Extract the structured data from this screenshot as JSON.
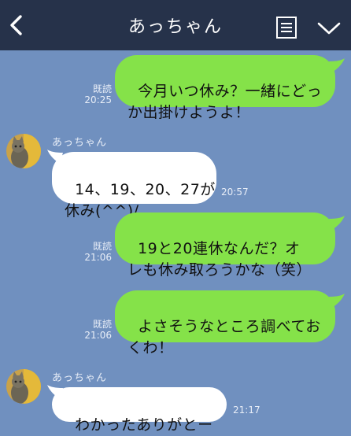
{
  "header": {
    "title": "あっちゃん",
    "back_icon": "chevron-left-icon",
    "memo_icon": "notes-icon",
    "menu_icon": "chevron-down-icon"
  },
  "colors": {
    "header_bg": "#26324a",
    "chat_bg": "#7090bf",
    "sent_bubble": "#85e249",
    "received_bubble": "#ffffff"
  },
  "messages": [
    {
      "direction": "sent",
      "text": "今月いつ休み？一緒にどっ\nか出掛けようよ！",
      "read": "既読",
      "time": "20:25"
    },
    {
      "direction": "received",
      "sender": "あっちゃん",
      "text": "14、19、20、27が\n休み(^^)/",
      "time": "20:57"
    },
    {
      "direction": "sent",
      "text": "19と20連休なんだ？オ\nレも休み取ろうかな（笑）",
      "read": "既読",
      "time": "21:06"
    },
    {
      "direction": "sent",
      "text": "よさそうなところ調べてお\nくわ！",
      "read": "既読",
      "time": "21:06"
    },
    {
      "direction": "received",
      "sender": "あっちゃん",
      "text": "わかったありがとー",
      "time": "21:17"
    }
  ]
}
